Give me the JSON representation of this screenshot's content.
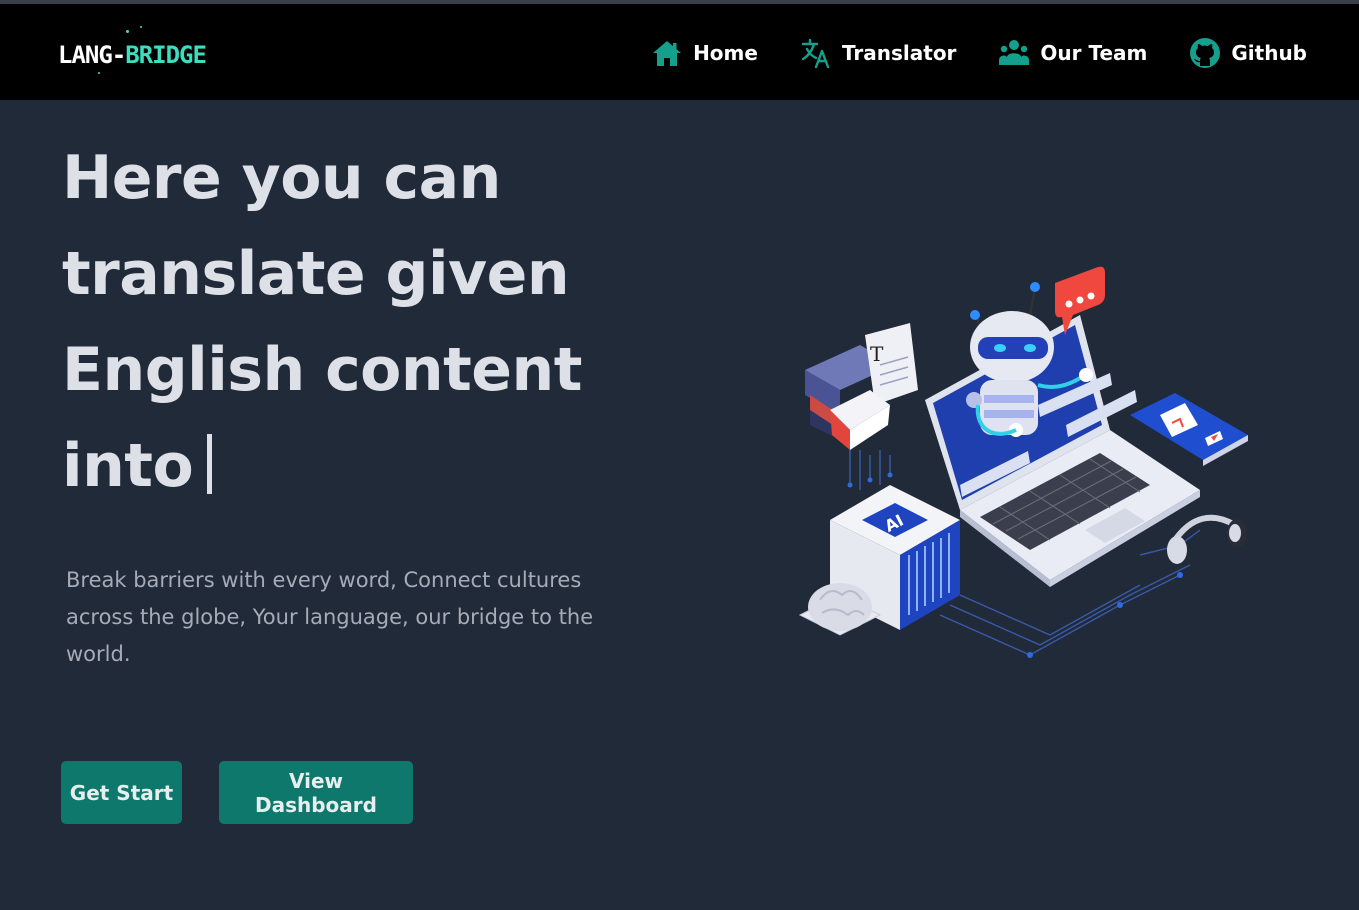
{
  "logo": {
    "part1": "LANG-",
    "part2": "BRIDGE"
  },
  "nav": [
    {
      "label": "Home",
      "icon": "home-icon"
    },
    {
      "label": "Translator",
      "icon": "translate-icon"
    },
    {
      "label": "Our Team",
      "icon": "team-icon"
    },
    {
      "label": "Github",
      "icon": "github-icon"
    }
  ],
  "hero": {
    "line1": "Here you can",
    "line2": "translate given",
    "line3": "English content",
    "line4": "into",
    "subtitle": "Break barriers with every word, Connect cultures across the globe, Your language, our bridge to the world."
  },
  "buttons": {
    "start": "Get Start",
    "dashboard": "View Dashboard"
  },
  "illustration": {
    "ai_label": "AI",
    "doc_letter": "T"
  },
  "colors": {
    "accent": "#0f786c",
    "logo_accent": "#3fdcc0",
    "nav_icon": "#14a08c",
    "background": "#212a39"
  }
}
